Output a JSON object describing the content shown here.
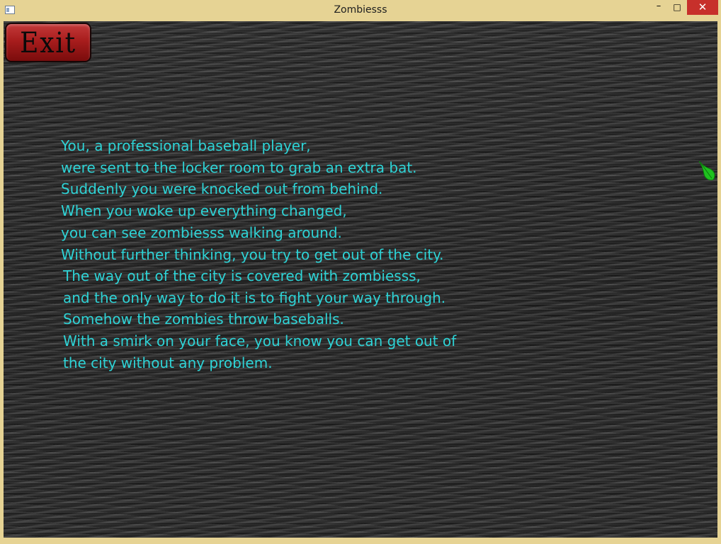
{
  "window": {
    "title": "Zombiesss",
    "minimize_glyph": "–",
    "maximize_glyph": "□",
    "close_glyph": "✕"
  },
  "game": {
    "exit_button_label": "Exit",
    "story_lines": [
      "You, a professional baseball player,",
      "were sent to the locker room to grab an extra bat.",
      "Suddenly you were knocked out from behind.",
      "When you woke up everything changed,",
      "you can see zombiesss walking around.",
      "Without further thinking, you try to get out of the city.",
      "The way out of the city is covered with zombiesss,",
      "and the only way to do it is to fight your way through.",
      "Somehow the zombies throw baseballs.",
      "With a smirk on your face, you know you can get out of",
      "the city without any problem."
    ],
    "text_color": "#2ed3d6",
    "exit_button_color": "#a81d1d",
    "leaf_color": "#1fc21f"
  }
}
